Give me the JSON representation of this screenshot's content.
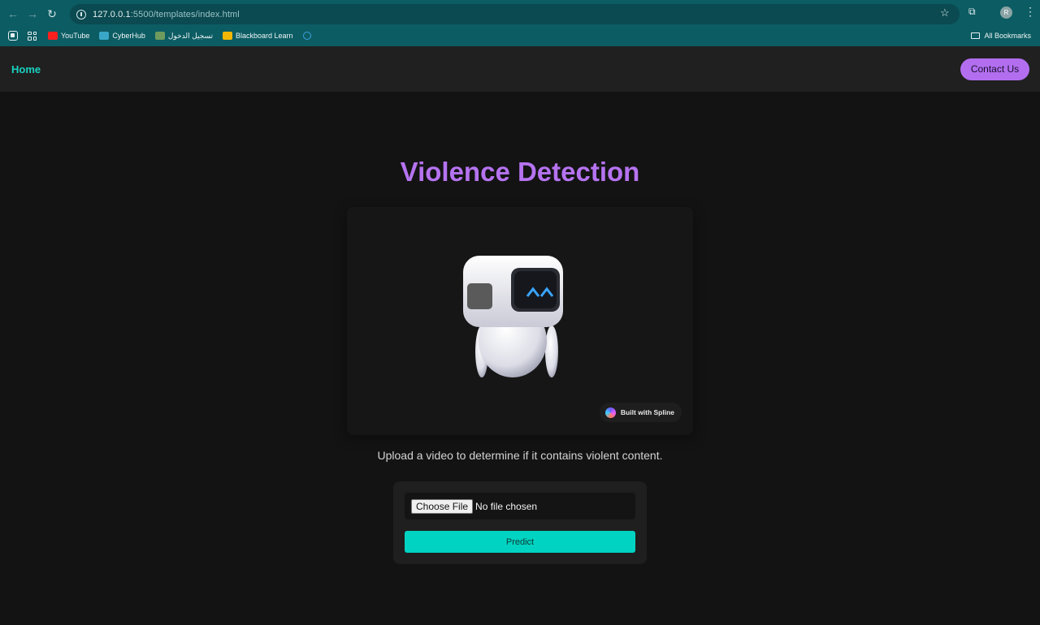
{
  "browser": {
    "url_host": "127.0.0.1",
    "url_rest": ":5500/templates/index.html",
    "profile_initial": "R",
    "bookmarks": [
      "YouTube",
      "CyberHub",
      "تسجيل الدخول",
      "Blackboard Learn"
    ],
    "all_bookmarks": "All Bookmarks"
  },
  "nav": {
    "home": "Home",
    "contact": "Contact Us"
  },
  "page": {
    "title": "Violence Detection",
    "spline_badge": "Built with Spline",
    "subtitle": "Upload a video to determine if it contains violent content.",
    "choose_file": "Choose File",
    "file_status": "No file chosen",
    "predict": "Predict"
  },
  "colors": {
    "accent_purple": "#b573f0",
    "accent_teal": "#00d3c1",
    "browser_chrome": "#0c5c63"
  }
}
